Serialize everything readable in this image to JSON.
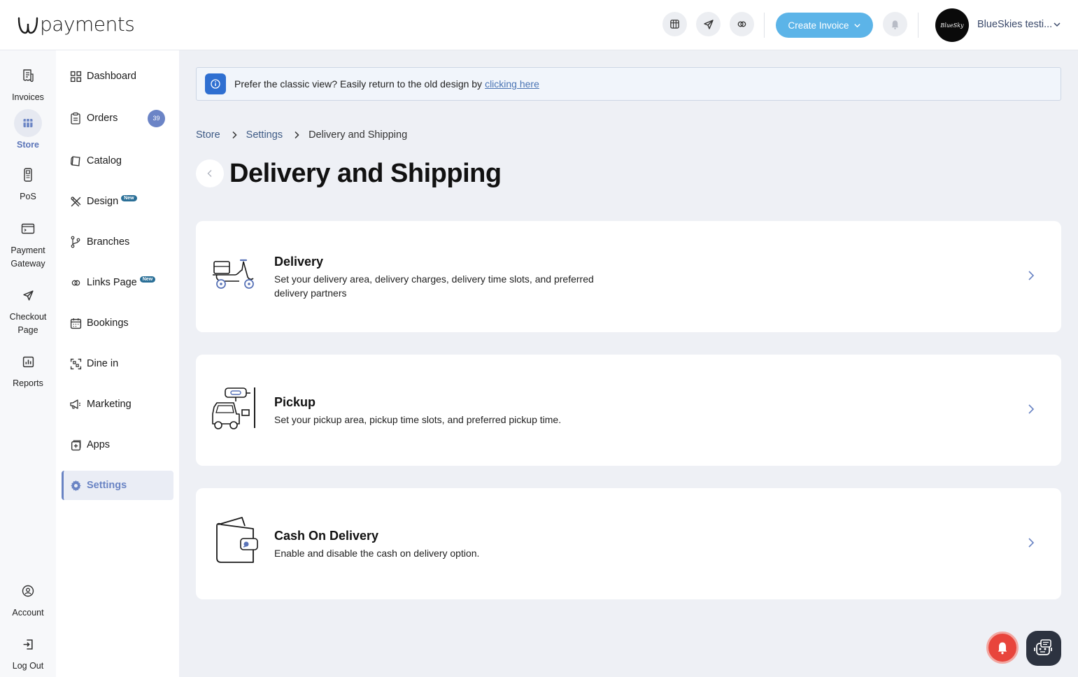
{
  "brand": {
    "name": "payments"
  },
  "header": {
    "create_invoice_label": "Create Invoice",
    "account_name": "BlueSkies testi...",
    "avatar_text": "BlueSky",
    "accent_color": "#5cb4e8"
  },
  "rail": {
    "items": [
      {
        "label": "Invoices",
        "icon": "invoice-icon"
      },
      {
        "label": "Store",
        "icon": "store-icon",
        "active": true
      },
      {
        "label": "PoS",
        "icon": "pos-icon"
      },
      {
        "label": "Payment Gateway",
        "icon": "payment-gateway-icon"
      },
      {
        "label": "Checkout Page",
        "icon": "send-icon"
      },
      {
        "label": "Reports",
        "icon": "reports-icon"
      },
      {
        "label": "Account",
        "icon": "account-icon"
      },
      {
        "label": "Log Out",
        "icon": "logout-icon"
      }
    ]
  },
  "sidebar": {
    "items": [
      {
        "label": "Dashboard",
        "icon": "dashboard-icon"
      },
      {
        "label": "Orders",
        "icon": "orders-icon",
        "badge": "39"
      },
      {
        "label": "Catalog",
        "icon": "catalog-icon"
      },
      {
        "label": "Design",
        "icon": "design-icon",
        "tag": "New"
      },
      {
        "label": "Branches",
        "icon": "branches-icon"
      },
      {
        "label": "Links Page",
        "icon": "links-icon",
        "tag": "New"
      },
      {
        "label": "Bookings",
        "icon": "calendar-icon"
      },
      {
        "label": "Dine in",
        "icon": "qr-icon"
      },
      {
        "label": "Marketing",
        "icon": "megaphone-icon"
      },
      {
        "label": "Apps",
        "icon": "apps-icon"
      },
      {
        "label": "Settings",
        "icon": "gear-icon",
        "active": true
      }
    ]
  },
  "banner": {
    "text": "Prefer the classic view? Easily return to the old design by",
    "link": "clicking here"
  },
  "breadcrumb": [
    "Store",
    "Settings",
    "Delivery and Shipping"
  ],
  "page_title": "Delivery and Shipping",
  "cards": [
    {
      "title": "Delivery",
      "description": "Set your delivery area, delivery charges, delivery time slots, and preferred delivery partners",
      "illustration": "scooter-illustration"
    },
    {
      "title": "Pickup",
      "description": "Set your pickup area, pickup time slots, and preferred pickup time.",
      "illustration": "pickup-car-illustration"
    },
    {
      "title": "Cash On Delivery",
      "description": "Enable and disable the cash on delivery option.",
      "illustration": "wallet-illustration"
    }
  ]
}
